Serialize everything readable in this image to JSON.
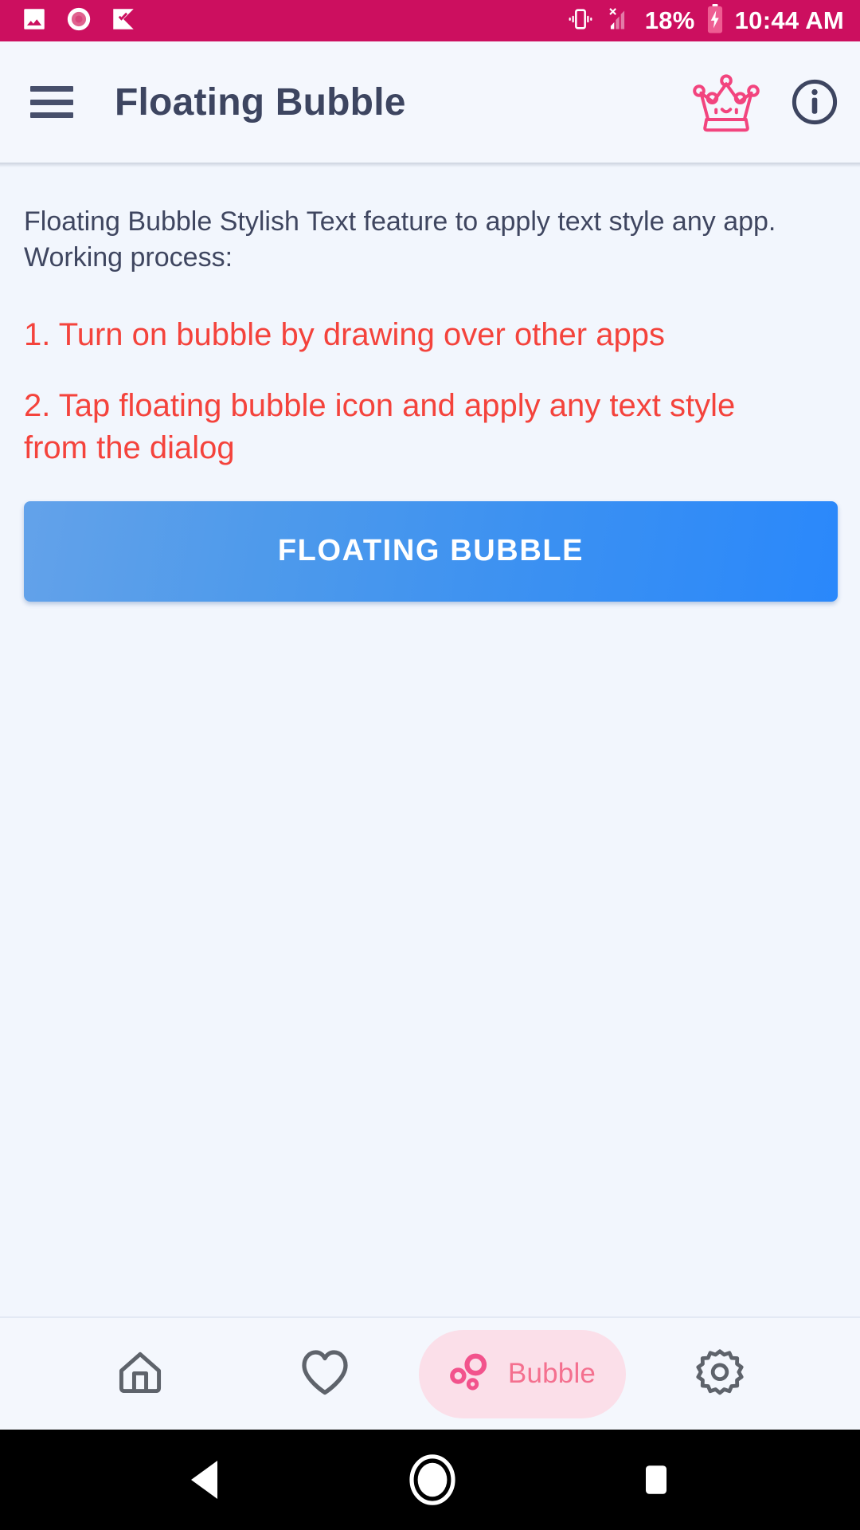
{
  "status_bar": {
    "background_color": "#cc0f5f",
    "left_icons": [
      {
        "name": "image-icon",
        "label": "image"
      },
      {
        "name": "record-circle-icon",
        "label": "record"
      },
      {
        "name": "check-flag-icon",
        "label": "checked"
      }
    ],
    "right_icons": [
      {
        "name": "vibrate-icon",
        "label": "vibrate"
      },
      {
        "name": "signal-no-sim-icon",
        "label": "no signal"
      }
    ],
    "battery_percent": "18%",
    "battery_icon": "battery-charging-icon",
    "clock": "10:44 AM"
  },
  "app_bar": {
    "menu_icon": "hamburger-menu-icon",
    "title": "Floating Bubble",
    "crown_icon": "crown-icon",
    "info_icon": "info-icon",
    "title_color": "#3d4560",
    "crown_color": "#f2447e"
  },
  "main": {
    "intro": "Floating Bubble Stylish Text feature to apply text style any app. Working process:",
    "steps": [
      "1. Turn on bubble by drawing over other apps",
      "2. Tap floating bubble icon and apply any text style from the dialog"
    ],
    "step_color": "#f4433c",
    "button": {
      "label": "FLOATING BUBBLE",
      "color_start": "#63a2ea",
      "color_end": "#2a88fb"
    }
  },
  "bottom_nav": {
    "items": [
      {
        "name": "nav-home",
        "icon": "home-icon",
        "label": "",
        "active": false
      },
      {
        "name": "nav-favorites",
        "icon": "heart-icon",
        "label": "",
        "active": false
      },
      {
        "name": "nav-bubble",
        "icon": "bubble-icon",
        "label": "Bubble",
        "active": true
      },
      {
        "name": "nav-settings",
        "icon": "gear-icon",
        "label": "",
        "active": false
      }
    ],
    "active_pill_bg": "#fbdfe9",
    "active_color": "#f4708f",
    "inactive_color": "#5e636b"
  },
  "android_nav": {
    "back": "back-triangle-icon",
    "home": "home-circle-icon",
    "recents": "recents-square-icon"
  }
}
